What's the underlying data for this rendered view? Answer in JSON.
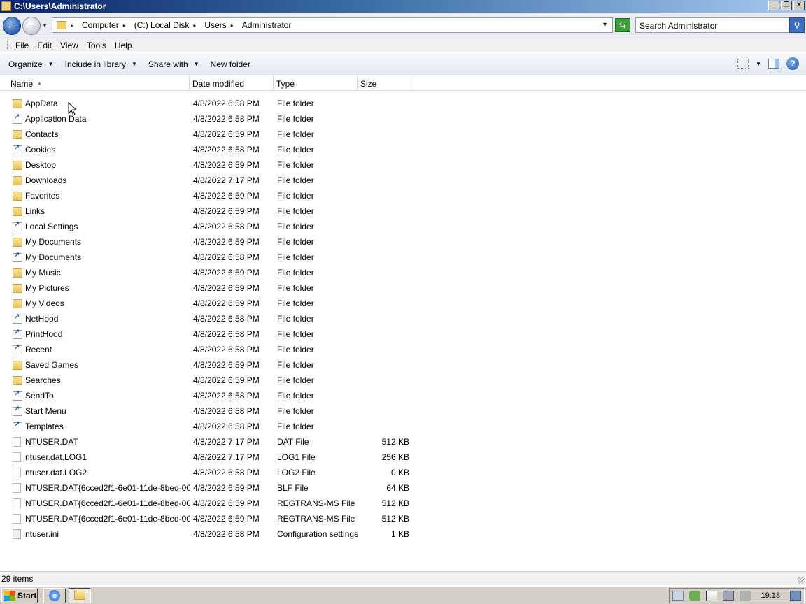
{
  "window": {
    "title": "C:\\Users\\Administrator",
    "minimize": "_",
    "restore": "❐",
    "close": "✕"
  },
  "address": {
    "crumbs": [
      "Computer",
      "(C:) Local Disk",
      "Users",
      "Administrator"
    ],
    "search_placeholder": "Search Administrator"
  },
  "menu": [
    "File",
    "Edit",
    "View",
    "Tools",
    "Help"
  ],
  "commands": {
    "organize": "Organize",
    "include_in_library": "Include in library",
    "share_with": "Share with",
    "new_folder": "New folder"
  },
  "columns": {
    "name": "Name",
    "date": "Date modified",
    "type": "Type",
    "size": "Size"
  },
  "files": [
    {
      "name": "AppData",
      "date": "4/8/2022 6:58 PM",
      "type": "File folder",
      "size": "",
      "icon": "folder-icon"
    },
    {
      "name": "Application Data",
      "date": "4/8/2022 6:58 PM",
      "type": "File folder",
      "size": "",
      "icon": "shortcut-folder-icon"
    },
    {
      "name": "Contacts",
      "date": "4/8/2022 6:59 PM",
      "type": "File folder",
      "size": "",
      "icon": "folder-icon"
    },
    {
      "name": "Cookies",
      "date": "4/8/2022 6:58 PM",
      "type": "File folder",
      "size": "",
      "icon": "shortcut-folder-icon"
    },
    {
      "name": "Desktop",
      "date": "4/8/2022 6:59 PM",
      "type": "File folder",
      "size": "",
      "icon": "folder-icon"
    },
    {
      "name": "Downloads",
      "date": "4/8/2022 7:17 PM",
      "type": "File folder",
      "size": "",
      "icon": "folder-icon"
    },
    {
      "name": "Favorites",
      "date": "4/8/2022 6:59 PM",
      "type": "File folder",
      "size": "",
      "icon": "folder-icon"
    },
    {
      "name": "Links",
      "date": "4/8/2022 6:59 PM",
      "type": "File folder",
      "size": "",
      "icon": "folder-icon"
    },
    {
      "name": "Local Settings",
      "date": "4/8/2022 6:58 PM",
      "type": "File folder",
      "size": "",
      "icon": "shortcut-folder-icon"
    },
    {
      "name": "My Documents",
      "date": "4/8/2022 6:59 PM",
      "type": "File folder",
      "size": "",
      "icon": "folder-icon"
    },
    {
      "name": "My Documents",
      "date": "4/8/2022 6:58 PM",
      "type": "File folder",
      "size": "",
      "icon": "shortcut-folder-icon"
    },
    {
      "name": "My Music",
      "date": "4/8/2022 6:59 PM",
      "type": "File folder",
      "size": "",
      "icon": "folder-icon"
    },
    {
      "name": "My Pictures",
      "date": "4/8/2022 6:59 PM",
      "type": "File folder",
      "size": "",
      "icon": "folder-icon"
    },
    {
      "name": "My Videos",
      "date": "4/8/2022 6:59 PM",
      "type": "File folder",
      "size": "",
      "icon": "folder-icon"
    },
    {
      "name": "NetHood",
      "date": "4/8/2022 6:58 PM",
      "type": "File folder",
      "size": "",
      "icon": "shortcut-folder-icon"
    },
    {
      "name": "PrintHood",
      "date": "4/8/2022 6:58 PM",
      "type": "File folder",
      "size": "",
      "icon": "shortcut-folder-icon"
    },
    {
      "name": "Recent",
      "date": "4/8/2022 6:58 PM",
      "type": "File folder",
      "size": "",
      "icon": "shortcut-folder-icon"
    },
    {
      "name": "Saved Games",
      "date": "4/8/2022 6:59 PM",
      "type": "File folder",
      "size": "",
      "icon": "folder-icon"
    },
    {
      "name": "Searches",
      "date": "4/8/2022 6:59 PM",
      "type": "File folder",
      "size": "",
      "icon": "folder-icon"
    },
    {
      "name": "SendTo",
      "date": "4/8/2022 6:58 PM",
      "type": "File folder",
      "size": "",
      "icon": "shortcut-folder-icon"
    },
    {
      "name": "Start Menu",
      "date": "4/8/2022 6:58 PM",
      "type": "File folder",
      "size": "",
      "icon": "shortcut-folder-icon"
    },
    {
      "name": "Templates",
      "date": "4/8/2022 6:58 PM",
      "type": "File folder",
      "size": "",
      "icon": "shortcut-folder-icon"
    },
    {
      "name": "NTUSER.DAT",
      "date": "4/8/2022 7:17 PM",
      "type": "DAT File",
      "size": "512 KB",
      "icon": "file-icon"
    },
    {
      "name": "ntuser.dat.LOG1",
      "date": "4/8/2022 7:17 PM",
      "type": "LOG1 File",
      "size": "256 KB",
      "icon": "file-icon"
    },
    {
      "name": "ntuser.dat.LOG2",
      "date": "4/8/2022 6:58 PM",
      "type": "LOG2 File",
      "size": "0 KB",
      "icon": "file-icon"
    },
    {
      "name": "NTUSER.DAT{6cced2f1-6e01-11de-8bed-00...",
      "date": "4/8/2022 6:59 PM",
      "type": "BLF File",
      "size": "64 KB",
      "icon": "file-icon"
    },
    {
      "name": "NTUSER.DAT{6cced2f1-6e01-11de-8bed-00...",
      "date": "4/8/2022 6:59 PM",
      "type": "REGTRANS-MS File",
      "size": "512 KB",
      "icon": "file-icon"
    },
    {
      "name": "NTUSER.DAT{6cced2f1-6e01-11de-8bed-00...",
      "date": "4/8/2022 6:59 PM",
      "type": "REGTRANS-MS File",
      "size": "512 KB",
      "icon": "file-icon"
    },
    {
      "name": "ntuser.ini",
      "date": "4/8/2022 6:58 PM",
      "type": "Configuration settings",
      "size": "1 KB",
      "icon": "config-file-icon"
    }
  ],
  "status": {
    "item_count": "29 items"
  },
  "taskbar": {
    "start_label": "Start",
    "clock": "19:18"
  }
}
